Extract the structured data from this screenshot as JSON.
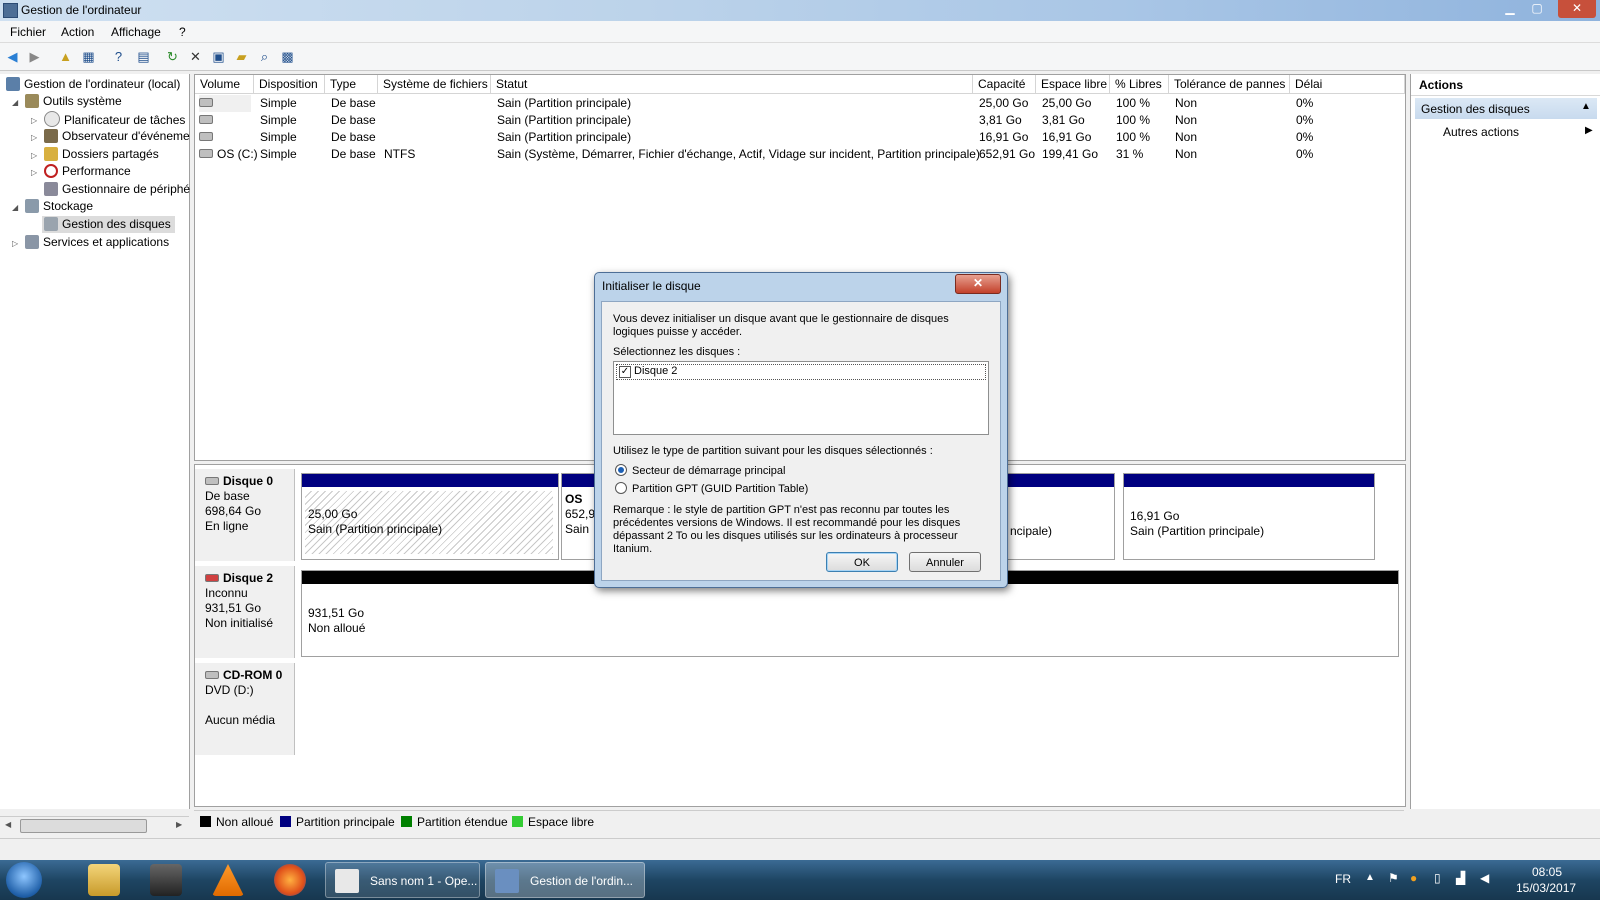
{
  "window": {
    "title": "Gestion de l'ordinateur",
    "minimize": "▁",
    "restore": "▢",
    "close": "✕"
  },
  "menubar": [
    "Fichier",
    "Action",
    "Affichage",
    "?"
  ],
  "tree": {
    "root": "Gestion de l'ordinateur (local)",
    "items": [
      {
        "label": "Outils système"
      },
      {
        "label": "Planificateur de tâches"
      },
      {
        "label": "Observateur d'événeme"
      },
      {
        "label": "Dossiers partagés"
      },
      {
        "label": "Performance"
      },
      {
        "label": "Gestionnaire de périphé"
      },
      {
        "label": "Stockage"
      },
      {
        "label": "Gestion des disques"
      },
      {
        "label": "Services et applications"
      }
    ]
  },
  "table": {
    "headers": [
      "Volume",
      "Disposition",
      "Type",
      "Système de fichiers",
      "Statut",
      "Capacité",
      "Espace libre",
      "% Libres",
      "Tolérance de pannes",
      "Délai"
    ],
    "rows": [
      [
        "",
        "Simple",
        "De base",
        "",
        "Sain (Partition principale)",
        "25,00 Go",
        "25,00 Go",
        "100 %",
        "Non",
        "0%"
      ],
      [
        "",
        "Simple",
        "De base",
        "",
        "Sain (Partition principale)",
        "3,81 Go",
        "3,81 Go",
        "100 %",
        "Non",
        "0%"
      ],
      [
        "",
        "Simple",
        "De base",
        "",
        "Sain (Partition principale)",
        "16,91 Go",
        "16,91 Go",
        "100 %",
        "Non",
        "0%"
      ],
      [
        "OS (C:)",
        "Simple",
        "De base",
        "NTFS",
        "Sain (Système, Démarrer, Fichier d'échange, Actif, Vidage sur incident, Partition principale)",
        "652,91 Go",
        "199,41 Go",
        "31 %",
        "Non",
        "0%"
      ]
    ]
  },
  "disks": {
    "disk0": {
      "name": "Disque 0",
      "type": "De base",
      "size": "698,64 Go",
      "state": "En ligne",
      "p1_size": "25,00 Go",
      "p1_status": "Sain (Partition principale)",
      "p2_name": "OS",
      "p2_size": "652,9",
      "p2_status": "Sain",
      "p3_status": "ncipale)",
      "p4_size": "16,91 Go",
      "p4_status": "Sain (Partition principale)"
    },
    "disk2": {
      "name": "Disque 2",
      "type": "Inconnu",
      "size": "931,51 Go",
      "state": "Non initialisé",
      "p_size": "931,51 Go",
      "p_status": "Non alloué"
    },
    "cdrom": {
      "name": "CD-ROM 0",
      "type": "DVD (D:)",
      "state": "Aucun média"
    }
  },
  "legend": [
    {
      "label": "Non alloué",
      "color": "#000000"
    },
    {
      "label": "Partition principale",
      "color": "#000080"
    },
    {
      "label": "Partition étendue",
      "color": "#008000"
    },
    {
      "label": "Espace libre",
      "color": "#33cc33"
    }
  ],
  "actions": {
    "header": "Actions",
    "section": "Gestion des disques",
    "other": "Autres actions"
  },
  "dialog": {
    "title": "Initialiser le disque",
    "close": "✕",
    "intro": "Vous devez initialiser un disque avant que le gestionnaire de disques logiques puisse y accéder.",
    "select_label": "Sélectionnez les disques :",
    "disk_item": "Disque 2",
    "disk_checked": true,
    "partition_label": "Utilisez le type de partition suivant pour les disques sélectionnés :",
    "option_mbr": "Secteur de démarrage principal",
    "option_gpt": "Partition GPT (GUID Partition Table)",
    "selected_option": "mbr",
    "note": "Remarque : le style de partition GPT n'est pas reconnu par toutes les précédentes versions de Windows. Il est recommandé pour les disques dépassant 2 To ou les disques utilisés sur les ordinateurs à processeur Itanium.",
    "ok": "OK",
    "cancel": "Annuler"
  },
  "taskbar": {
    "task1": "Sans nom 1 - Ope...",
    "task2": "Gestion de l'ordin...",
    "lang": "FR",
    "time": "08:05",
    "date": "15/03/2017"
  }
}
